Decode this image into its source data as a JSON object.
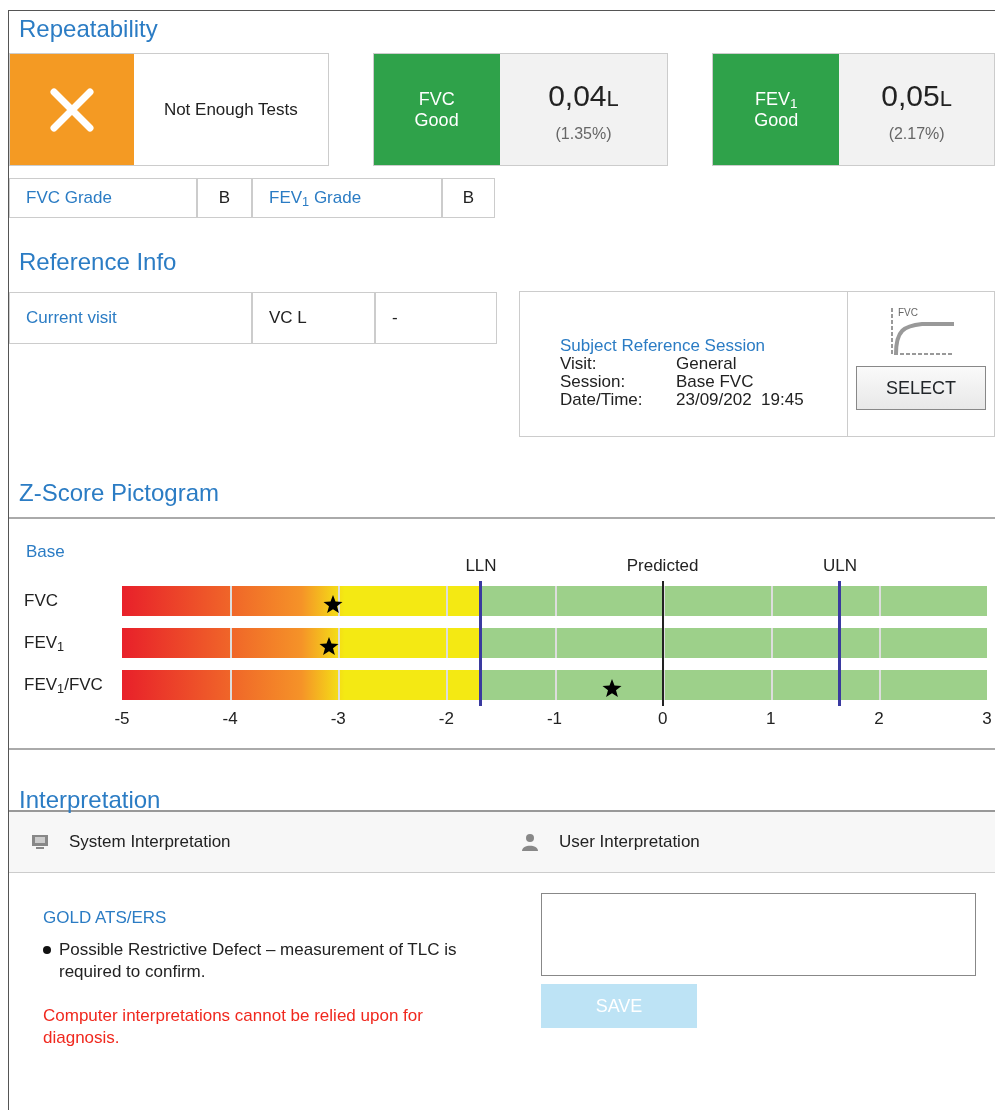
{
  "repeatability": {
    "title": "Repeatability",
    "status": {
      "kind": "fail",
      "text": "Not Enough Tests"
    },
    "measures": [
      {
        "label": "FVC",
        "quality": "Good",
        "kind": "good",
        "value": "0,04",
        "unit": "L",
        "percent": "(1.35%)"
      },
      {
        "label": "FEV$_{1}$",
        "quality": "Good",
        "kind": "good",
        "value": "0,05",
        "unit": "L",
        "percent": "(2.17%)"
      }
    ],
    "grades": [
      {
        "label": "FVC Grade",
        "value": "B"
      },
      {
        "label": "FEV$_{1}$ Grade",
        "value": "B"
      }
    ]
  },
  "reference_info": {
    "title": "Reference Info",
    "visit": {
      "label": "Current visit",
      "parameter": "VC L",
      "value": "-"
    },
    "session": {
      "title": "Subject Reference Session",
      "fields": [
        {
          "label": "Visit:",
          "value": "General"
        },
        {
          "label": "Session:",
          "value": "Base FVC"
        },
        {
          "label": "Date/Time:",
          "value": "23/09/202  19:45"
        }
      ]
    },
    "curve_label": "FVC",
    "select_button": "SELECT"
  },
  "pictogram": {
    "title": "Z-Score Pictogram",
    "subtitle": "Base",
    "markers": [
      {
        "label": "LLN",
        "level": 0.415
      },
      {
        "label": "Predicted",
        "level": 0.625
      },
      {
        "label": "ULN",
        "level": 0.83
      }
    ],
    "rows": [
      {
        "label": "FVC",
        "level": 0.244
      },
      {
        "label": "FEV$_{1}$",
        "level": 0.239
      },
      {
        "label": "FEV$_{1}$/FVC",
        "level": 0.566
      }
    ],
    "scale": [
      "-5",
      "-4",
      "-3",
      "-2",
      "-1",
      "0",
      "1",
      "2",
      "3"
    ]
  },
  "interpretation": {
    "title": "Interpretation",
    "tabs": [
      {
        "label": "System Interpretation",
        "kind": "system"
      },
      {
        "label": "User Interpretation",
        "kind": "user"
      }
    ],
    "standard": "GOLD ATS/ERS",
    "findings": [
      "Possible Restrictive Defect – measurement of TLC is required to confirm."
    ],
    "warning": "Computer interpretations cannot be relied upon for diagnosis.",
    "save_button": {
      "label": "SAVE",
      "disabled": true
    }
  }
}
